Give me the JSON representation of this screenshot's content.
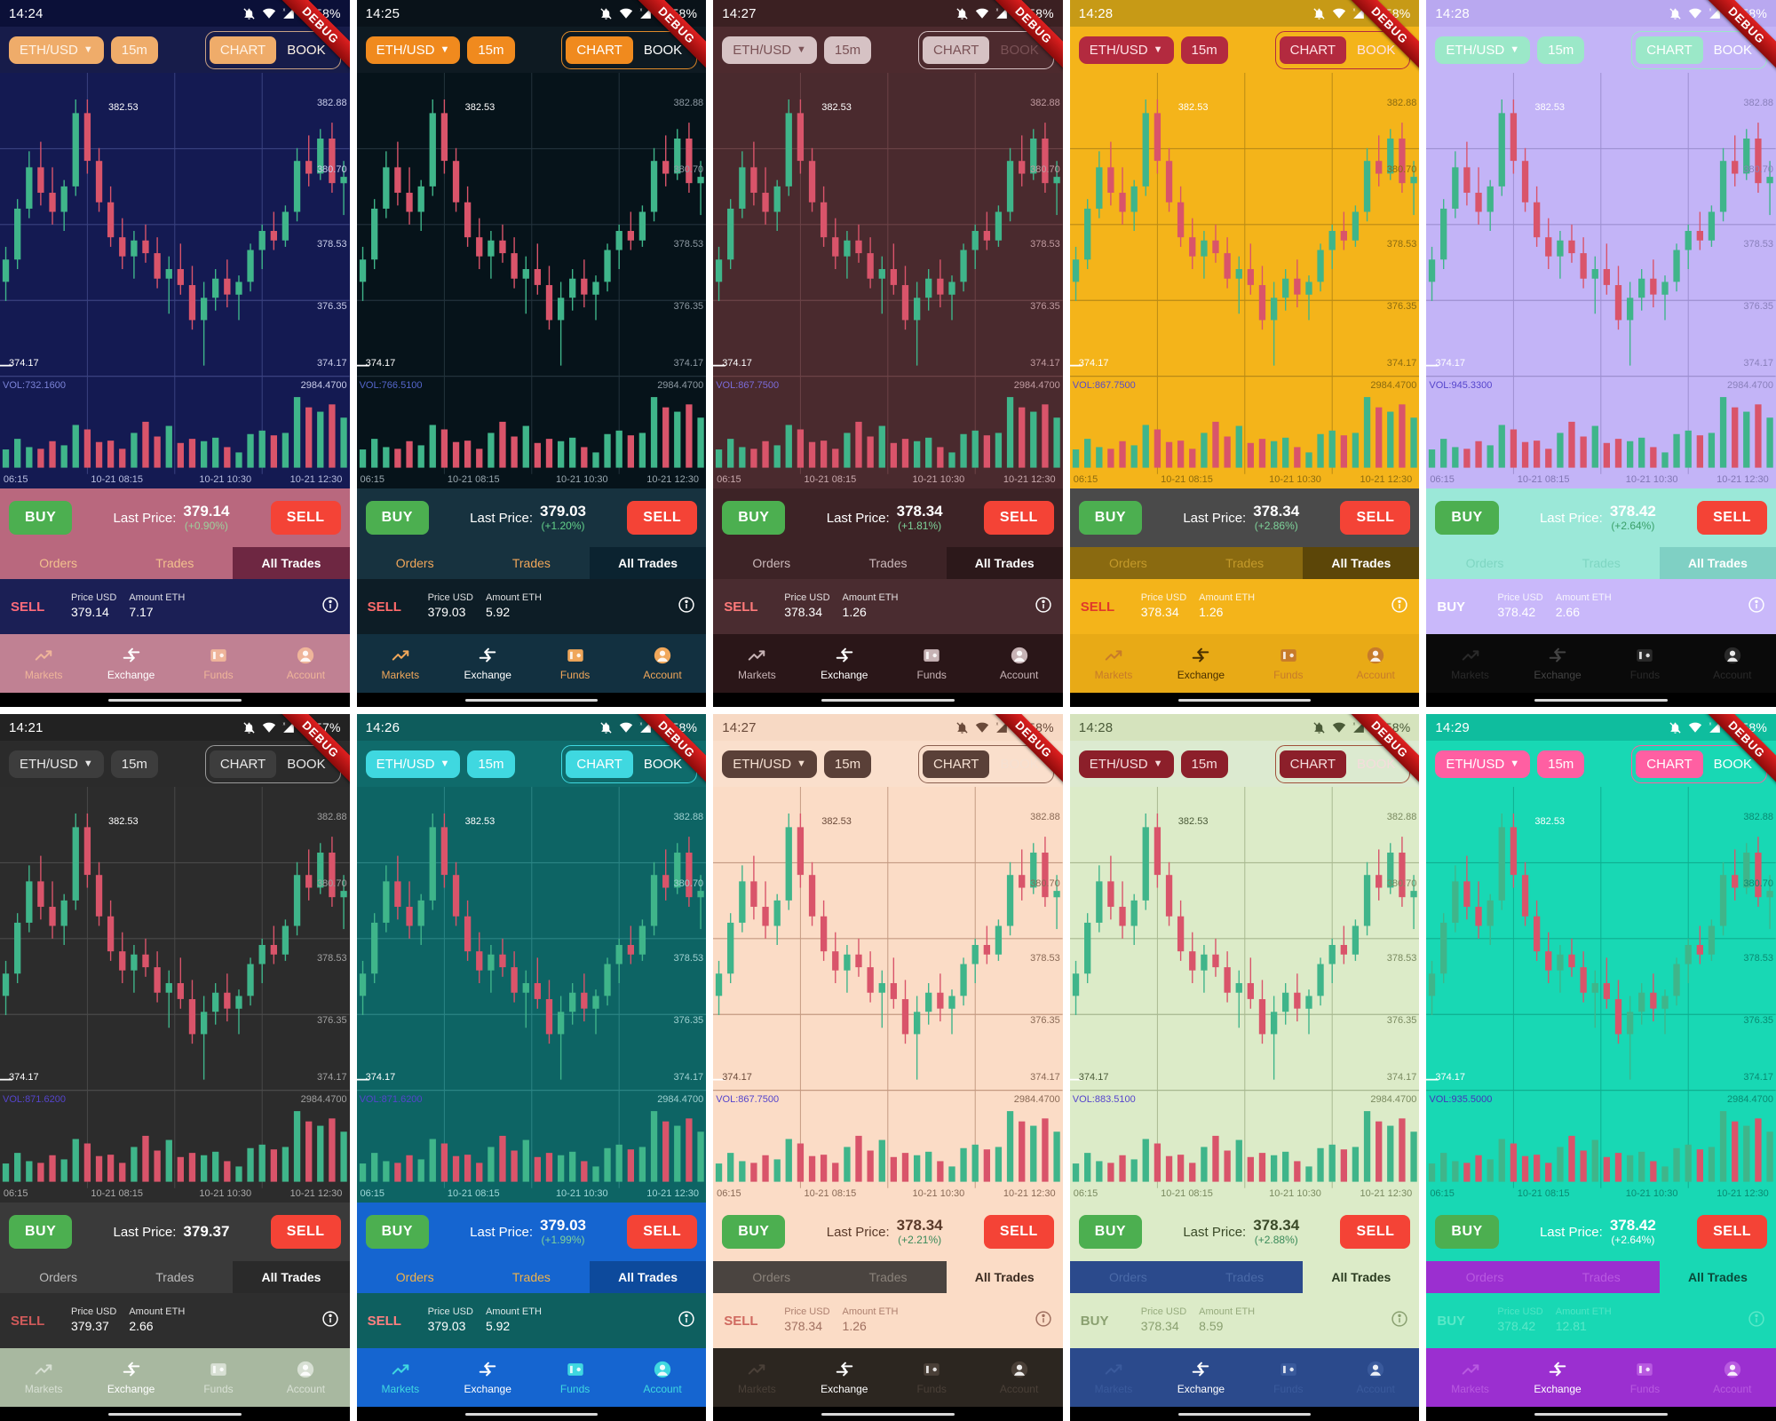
{
  "ribbon_label": "DEBUG",
  "common": {
    "pair_label": "ETH/USD",
    "interval_label": "15m",
    "chart_label": "CHART",
    "book_label": "BOOK",
    "buy_label": "BUY",
    "sell_label": "SELL",
    "last_price_label": "Last Price:",
    "tabs": [
      "Orders",
      "Trades",
      "All Trades"
    ],
    "trade_price_header": "Price USD",
    "trade_amount_header": "Amount ETH",
    "nav": [
      {
        "label": "Markets",
        "icon": "trending-up-icon"
      },
      {
        "label": "Exchange",
        "icon": "exchange-arrows-icon"
      },
      {
        "label": "Funds",
        "icon": "wallet-icon"
      },
      {
        "label": "Account",
        "icon": "account-circle-icon"
      }
    ],
    "axis_time_labels": [
      "06:15",
      "10-21 08:15",
      "10-21 10:30",
      "10-21 12:30"
    ],
    "price_labels": {
      "high": "382.53",
      "top_right": "382.88",
      "mid_right": "380.70",
      "mid2_right": "378.53",
      "low_right": "376.35",
      "low": "374.17",
      "low_right2": "374.17",
      "vol_right": "2984.4700"
    },
    "status_icons": [
      "bell-off-icon",
      "wifi-icon",
      "signal-x-icon",
      "signal-icon"
    ]
  },
  "chart_data": {
    "type": "candlestick",
    "title": "ETH/USD 15m",
    "xlabel": "",
    "ylabel": "Price USD",
    "ylim": [
      374.17,
      382.88
    ],
    "gridlines": true,
    "tick_labels_x": [
      "06:15",
      "10-21 08:15",
      "10-21 10:30",
      "10-21 12:30"
    ],
    "tick_labels_y": [
      "382.88",
      "380.70",
      "378.53",
      "376.35",
      "374.17"
    ],
    "annotations": {
      "high": "382.53",
      "low": "374.17"
    },
    "volume_max_label": "2984.4700",
    "candles": [
      {
        "o": 376.8,
        "h": 377.9,
        "l": 376.2,
        "c": 377.5,
        "v": 620
      },
      {
        "o": 377.5,
        "h": 379.4,
        "l": 377.2,
        "c": 379.1,
        "v": 980
      },
      {
        "o": 379.1,
        "h": 380.9,
        "l": 378.8,
        "c": 380.4,
        "v": 700
      },
      {
        "o": 380.4,
        "h": 381.2,
        "l": 379.2,
        "c": 379.6,
        "v": 640
      },
      {
        "o": 379.6,
        "h": 380.4,
        "l": 378.6,
        "c": 379.0,
        "v": 900
      },
      {
        "o": 379.0,
        "h": 380.0,
        "l": 378.4,
        "c": 379.8,
        "v": 760
      },
      {
        "o": 379.8,
        "h": 382.53,
        "l": 379.5,
        "c": 382.1,
        "v": 1450
      },
      {
        "o": 382.1,
        "h": 382.53,
        "l": 380.2,
        "c": 380.6,
        "v": 1300
      },
      {
        "o": 380.6,
        "h": 381.0,
        "l": 379.0,
        "c": 379.3,
        "v": 870
      },
      {
        "o": 379.3,
        "h": 379.8,
        "l": 377.9,
        "c": 378.2,
        "v": 920
      },
      {
        "o": 378.2,
        "h": 378.8,
        "l": 377.2,
        "c": 377.6,
        "v": 640
      },
      {
        "o": 377.6,
        "h": 378.4,
        "l": 376.9,
        "c": 378.1,
        "v": 1180
      },
      {
        "o": 378.1,
        "h": 378.6,
        "l": 377.4,
        "c": 377.7,
        "v": 1560
      },
      {
        "o": 377.7,
        "h": 378.2,
        "l": 376.6,
        "c": 376.9,
        "v": 1060
      },
      {
        "o": 376.9,
        "h": 377.6,
        "l": 375.8,
        "c": 377.2,
        "v": 1420
      },
      {
        "o": 377.2,
        "h": 378.0,
        "l": 376.4,
        "c": 376.7,
        "v": 840
      },
      {
        "o": 376.7,
        "h": 377.3,
        "l": 375.3,
        "c": 375.6,
        "v": 980
      },
      {
        "o": 375.6,
        "h": 376.8,
        "l": 374.17,
        "c": 376.3,
        "v": 900
      },
      {
        "o": 376.3,
        "h": 377.2,
        "l": 375.9,
        "c": 376.9,
        "v": 1020
      },
      {
        "o": 376.9,
        "h": 377.5,
        "l": 376.0,
        "c": 376.4,
        "v": 700
      },
      {
        "o": 376.4,
        "h": 377.0,
        "l": 375.6,
        "c": 376.8,
        "v": 520
      },
      {
        "o": 376.8,
        "h": 378.0,
        "l": 376.5,
        "c": 377.8,
        "v": 1140
      },
      {
        "o": 377.8,
        "h": 378.6,
        "l": 377.2,
        "c": 378.4,
        "v": 1260
      },
      {
        "o": 378.4,
        "h": 379.0,
        "l": 377.8,
        "c": 378.1,
        "v": 1100
      },
      {
        "o": 378.1,
        "h": 379.2,
        "l": 377.9,
        "c": 379.0,
        "v": 1180
      },
      {
        "o": 379.0,
        "h": 381.0,
        "l": 378.7,
        "c": 380.6,
        "v": 2400
      },
      {
        "o": 380.6,
        "h": 381.4,
        "l": 379.8,
        "c": 380.2,
        "v": 2050
      },
      {
        "o": 380.2,
        "h": 381.6,
        "l": 380.0,
        "c": 381.3,
        "v": 1900
      },
      {
        "o": 381.3,
        "h": 381.8,
        "l": 379.6,
        "c": 379.9,
        "v": 2150
      },
      {
        "o": 379.9,
        "h": 380.6,
        "l": 378.9,
        "c": 380.1,
        "v": 1700
      }
    ]
  },
  "screens": [
    {
      "id": "screen-1",
      "time": "14:24",
      "battery": "58%",
      "vol_text": "VOL:732.1600",
      "last_price": "379.14",
      "change": "(+0.90%)",
      "active_tab": 2,
      "trade_side": "SELL",
      "trade_price": "379.14",
      "trade_amount": "7.17",
      "nav_active": 1,
      "theme": {
        "status_bg": "#0b1038",
        "status_fg": "#ffffff",
        "toolbar_bg": "#171c4a",
        "pill_bg": "#efac6a",
        "pill_fg": "#fff3e6",
        "seg_border": "#c8a184",
        "chart_bg": "#141a52",
        "grid": "#3a4280",
        "axis_fg": "#b9bfe0",
        "price_bg": "#b9687e",
        "price_fg": "#ffffff",
        "chg_fg": "#9cd19c",
        "tabs_bg": "#b9687e",
        "tab_fg": "#f3c08e",
        "tab_active_bg": "#6e2742",
        "tab_active_fg": "#ffffff",
        "row_bg": "#1b1f55",
        "row_fg": "#ffffff",
        "side_fg": "#ff6b7a",
        "nav_bg": "#c08193",
        "nav_fg": "#efb59a",
        "nav_active_fg": "#ffffff",
        "vol_fg": "#7b83d8",
        "price_lbl_fg": "#c9cdea"
      }
    },
    {
      "id": "screen-2",
      "time": "14:25",
      "battery": "58%",
      "vol_text": "VOL:766.5100",
      "last_price": "379.03",
      "change": "(+1.20%)",
      "active_tab": 2,
      "trade_side": "SELL",
      "trade_price": "379.03",
      "trade_amount": "5.92",
      "nav_active": 1,
      "theme": {
        "status_bg": "#091219",
        "status_fg": "#ffffff",
        "toolbar_bg": "#0e1a22",
        "pill_bg": "#f08a1e",
        "pill_fg": "#ffffff",
        "seg_border": "#e08a2a",
        "chart_bg": "#06131a",
        "grid": "#23333c",
        "axis_fg": "#9aa8b0",
        "price_bg": "#17323f",
        "price_fg": "#ffffff",
        "chg_fg": "#63d08a",
        "tabs_bg": "#17323f",
        "tab_fg": "#f0a75a",
        "tab_active_bg": "#0b2330",
        "tab_active_fg": "#ffffff",
        "row_bg": "#0d1d26",
        "row_fg": "#ffffff",
        "side_fg": "#ff6b6b",
        "nav_bg": "#123040",
        "nav_fg": "#f0a75a",
        "nav_active_fg": "#ffffff",
        "vol_fg": "#5566cc",
        "price_lbl_fg": "#8e9aa3"
      }
    },
    {
      "id": "screen-3",
      "time": "14:27",
      "battery": "58%",
      "vol_text": "VOL:867.7500",
      "last_price": "378.34",
      "change": "(+1.81%)",
      "active_tab": 2,
      "trade_side": "SELL",
      "trade_price": "378.34",
      "trade_amount": "1.26",
      "nav_active": 1,
      "theme": {
        "status_bg": "#3b2022",
        "status_fg": "#ffffff",
        "toolbar_bg": "#4d2a2e",
        "pill_bg": "#d6c2c4",
        "pill_fg": "#7a5256",
        "seg_border": "#d6c2c4",
        "chart_bg": "#4a2a2e",
        "grid": "#6c4347",
        "axis_fg": "#c9a9ad",
        "price_bg": "#3d2326",
        "price_fg": "#ffffff",
        "chg_fg": "#7ed39a",
        "tabs_bg": "#3d2326",
        "tab_fg": "#cbb8ba",
        "tab_active_bg": "#2c181a",
        "tab_active_fg": "#ffffff",
        "row_bg": "#4a2c30",
        "row_fg": "#ffffff",
        "side_fg": "#ff7a7a",
        "nav_bg": "#2a1618",
        "nav_fg": "#c7b3b5",
        "nav_active_fg": "#ffffff",
        "vol_fg": "#7b6bd8",
        "price_lbl_fg": "#c09ba0"
      }
    },
    {
      "id": "screen-4",
      "time": "14:28",
      "battery": "58%",
      "vol_text": "VOL:867.7500",
      "last_price": "378.34",
      "change": "(+2.86%)",
      "active_tab": 2,
      "trade_side": "SELL",
      "trade_price": "378.34",
      "trade_amount": "1.26",
      "nav_active": 1,
      "theme": {
        "status_bg": "#c79a16",
        "status_fg": "#ffffff",
        "toolbar_bg": "#f4b41a",
        "pill_bg": "#b32a3f",
        "pill_fg": "#ffe2e6",
        "seg_border": "#b32a3f",
        "chart_bg": "#f4b41a",
        "grid": "#b98a16",
        "axis_fg": "#8a6a10",
        "price_bg": "#4a4a4a",
        "price_fg": "#ffffff",
        "chg_fg": "#7ed39a",
        "tabs_bg": "#8a6a10",
        "tab_fg": "#c49a2a",
        "tab_active_bg": "#5c4608",
        "tab_active_fg": "#ffffff",
        "row_bg": "#f4b41a",
        "row_fg": "#ffffff",
        "side_fg": "#e0392b",
        "nav_bg": "#e8aa16",
        "nav_fg": "#c77b2a",
        "nav_active_fg": "#4a3000",
        "vol_fg": "#5a4ac8",
        "price_lbl_fg": "#8a6a10"
      }
    },
    {
      "id": "screen-5",
      "time": "14:28",
      "battery": "58%",
      "vol_text": "VOL:945.3300",
      "last_price": "378.42",
      "change": "(+2.64%)",
      "active_tab": 2,
      "trade_side": "BUY",
      "trade_price": "378.42",
      "trade_amount": "2.66",
      "nav_active": 1,
      "theme": {
        "status_bg": "#b9a8f0",
        "status_fg": "#ffffff",
        "toolbar_bg": "#c3b4f7",
        "pill_bg": "#9be8c8",
        "pill_fg": "#ffffff",
        "seg_border": "#9be8c8",
        "chart_bg": "#c3b4f7",
        "grid": "#9d8fd0",
        "axis_fg": "#8176b3",
        "price_bg": "#9be8d8",
        "price_fg": "#ffffff",
        "chg_fg": "#3aa06a",
        "tabs_bg": "#9be8d8",
        "tab_fg": "#7fd6c2",
        "tab_active_bg": "#7fd0c4",
        "tab_active_fg": "#ffffff",
        "row_bg": "#c9b8fa",
        "row_fg": "#ffffff",
        "side_fg": "#ffffff",
        "nav_bg": "#0a0a0a",
        "nav_fg": "#2a2a2a",
        "nav_active_fg": "#444444",
        "vol_fg": "#5544cc",
        "price_lbl_fg": "#8a80bb"
      }
    },
    {
      "id": "screen-6",
      "time": "14:21",
      "battery": "57%",
      "vol_text": "VOL:871.6200",
      "last_price": "379.37",
      "change": "",
      "active_tab": 2,
      "trade_side": "SELL",
      "trade_price": "379.37",
      "trade_amount": "2.66",
      "nav_active": 1,
      "theme": {
        "status_bg": "#222222",
        "status_fg": "#ffffff",
        "toolbar_bg": "#2b2b2b",
        "pill_bg": "#3d3d3d",
        "pill_fg": "#e8e8e8",
        "seg_border": "#9a9a9a",
        "chart_bg": "#2c2c2c",
        "grid": "#4a4a4a",
        "axis_fg": "#aaaaaa",
        "price_bg": "#3a3a3a",
        "price_fg": "#ffffff",
        "chg_fg": "#7ed39a",
        "tabs_bg": "#3a3a3a",
        "tab_fg": "#bbbbbb",
        "tab_active_bg": "#2a2a2a",
        "tab_active_fg": "#ffffff",
        "row_bg": "#2e2e2e",
        "row_fg": "#ffffff",
        "side_fg": "#d05a5a",
        "nav_bg": "#a8b8a0",
        "nav_fg": "#d8e0d4",
        "nav_active_fg": "#ffffff",
        "vol_fg": "#5544cc",
        "price_lbl_fg": "#a0a0a0"
      }
    },
    {
      "id": "screen-7",
      "time": "14:26",
      "battery": "58%",
      "vol_text": "VOL:871.6200",
      "last_price": "379.03",
      "change": "(+1.99%)",
      "active_tab": 2,
      "trade_side": "SELL",
      "trade_price": "379.03",
      "trade_amount": "5.92",
      "nav_active": 1,
      "theme": {
        "status_bg": "#0e5c5c",
        "status_fg": "#ffffff",
        "toolbar_bg": "#0f6b6b",
        "pill_bg": "#3fd8e0",
        "pill_fg": "#ffffff",
        "seg_border": "#3fd8e0",
        "chart_bg": "#0d6464",
        "grid": "#2b8585",
        "axis_fg": "#9fd8d8",
        "price_bg": "#1565d0",
        "price_fg": "#ffffff",
        "chg_fg": "#7ed39a",
        "tabs_bg": "#1565d0",
        "tab_fg": "#f0b24a",
        "tab_active_bg": "#0d4a9c",
        "tab_active_fg": "#ffffff",
        "row_bg": "#0e5f5f",
        "row_fg": "#ffffff",
        "side_fg": "#ff8080",
        "nav_bg": "#1565d0",
        "nav_fg": "#3fd8e0",
        "nav_active_fg": "#ffffff",
        "vol_fg": "#5544cc",
        "price_lbl_fg": "#9fd0d0"
      }
    },
    {
      "id": "screen-8",
      "time": "14:27",
      "battery": "58%",
      "vol_text": "VOL:867.7500",
      "last_price": "378.34",
      "change": "(+2.21%)",
      "active_tab": 2,
      "trade_side": "SELL",
      "trade_price": "378.34",
      "trade_amount": "1.26",
      "nav_active": 1,
      "theme": {
        "status_bg": "#f7d9c4",
        "status_fg": "#6a4a3a",
        "toolbar_bg": "#fadfcc",
        "pill_bg": "#5a4038",
        "pill_fg": "#f5e0d2",
        "seg_border": "#8a6050",
        "chart_bg": "#fbdcc6",
        "grid": "#c49a82",
        "axis_fg": "#8a6a56",
        "price_bg": "#fbdcc6",
        "price_fg": "#5a3a2a",
        "chg_fg": "#3a8a5a",
        "tabs_bg": "#4a4440",
        "tab_fg": "#8a827a",
        "tab_active_bg": "#fbdcc6",
        "tab_active_fg": "#3a2a20",
        "row_bg": "#fbdcc6",
        "row_fg": "#a07060",
        "side_fg": "#d06a60",
        "nav_bg": "#2c2620",
        "nav_fg": "#4a4038",
        "nav_active_fg": "#ffffff",
        "vol_fg": "#5544cc",
        "price_lbl_fg": "#8a6a56"
      }
    },
    {
      "id": "screen-9",
      "time": "14:28",
      "battery": "58%",
      "vol_text": "VOL:883.5100",
      "last_price": "378.34",
      "change": "(+2.88%)",
      "active_tab": 2,
      "trade_side": "BUY",
      "trade_price": "378.34",
      "trade_amount": "8.59",
      "nav_active": 1,
      "theme": {
        "status_bg": "#d5e3bd",
        "status_fg": "#4a5a38",
        "toolbar_bg": "#dcead0",
        "pill_bg": "#8c1f2a",
        "pill_fg": "#f5dcdc",
        "seg_border": "#a0503a",
        "chart_bg": "#dcebc8",
        "grid": "#a8b890",
        "axis_fg": "#7a8a60",
        "price_bg": "#dcebc8",
        "price_fg": "#3a4a28",
        "chg_fg": "#3a8a5a",
        "tabs_bg": "#2b4a8c",
        "tab_fg": "#4a6aa8",
        "tab_active_bg": "#dcebc8",
        "tab_active_fg": "#2a3a20",
        "row_bg": "#dcebc8",
        "row_fg": "#8aa070",
        "side_fg": "#8aa070",
        "nav_bg": "#2b4a8c",
        "nav_fg": "#3a5a9c",
        "nav_active_fg": "#ffffff",
        "vol_fg": "#5544cc",
        "price_lbl_fg": "#7a8a60"
      }
    },
    {
      "id": "screen-10",
      "time": "14:29",
      "battery": "58%",
      "vol_text": "VOL:935.5000",
      "last_price": "378.42",
      "change": "(+2.64%)",
      "active_tab": 2,
      "trade_side": "BUY",
      "trade_price": "378.42",
      "trade_amount": "12.81",
      "nav_active": 1,
      "theme": {
        "status_bg": "#0fbd9e",
        "status_fg": "#ffffff",
        "toolbar_bg": "#18d8b4",
        "pill_bg": "#ff5fa2",
        "pill_fg": "#ffffff",
        "seg_border": "#ff5fa2",
        "chart_bg": "#18d8b4",
        "grid": "#0fae90",
        "axis_fg": "#0a8a72",
        "price_bg": "#18d8b4",
        "price_fg": "#ffffff",
        "chg_fg": "#ffffff",
        "tabs_bg": "#9b2fd0",
        "tab_fg": "#b85ae0",
        "tab_active_bg": "#18d8b4",
        "tab_active_fg": "#0a4a3a",
        "row_bg": "#18d8b4",
        "row_fg": "#5ae8c8",
        "side_fg": "#5ae8c8",
        "nav_bg": "#9b2fd0",
        "nav_fg": "#b85ae0",
        "nav_active_fg": "#ffffff",
        "vol_fg": "#4433bb",
        "price_lbl_fg": "#0a8a72"
      }
    }
  ]
}
